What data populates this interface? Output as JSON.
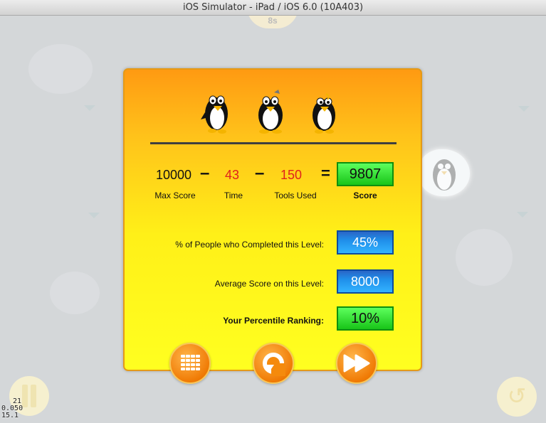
{
  "window": {
    "title": "iOS Simulator - iPad / iOS 6.0 (10A403)"
  },
  "hud": {
    "timer": "8s",
    "debug": [
      "21",
      "0.050",
      "15.1"
    ]
  },
  "results": {
    "equation": {
      "max_score": "10000",
      "max_score_label": "Max Score",
      "minus_1": "–",
      "time": "43",
      "time_label": "Time",
      "minus_2": "–",
      "tools_used": "150",
      "tools_used_label": "Tools Used",
      "equals": "=",
      "score": "9807",
      "score_label": "Score"
    },
    "stats": [
      {
        "label": "% of People who Completed this Level:",
        "value": "45%"
      },
      {
        "label": "Average Score on this Level:",
        "value": "8000"
      },
      {
        "label": "Your Percentile Ranking:",
        "value": "10%"
      }
    ],
    "colors": {
      "minus_values": "#e0221b",
      "panel_top": "#ff9a12",
      "panel_bottom": "#ffff20"
    }
  },
  "buttons": {
    "level_select_icon": "grid-icon",
    "replay_icon": "replay-icon",
    "next_icon": "fast-forward-icon",
    "pause_icon": "pause-icon",
    "corner_replay_icon": "replay-icon"
  }
}
